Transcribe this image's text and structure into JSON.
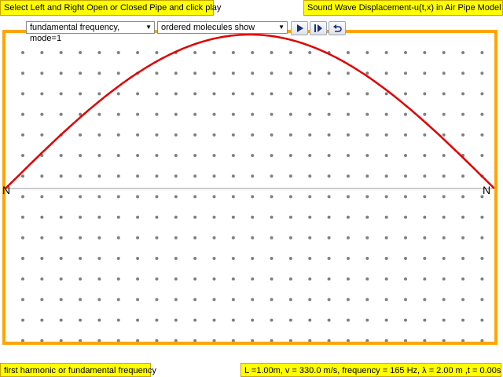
{
  "labels": {
    "top_left": "Select Left and Right Open or Closed Pipe and click play",
    "top_right": "Sound Wave Displacement-u(t,x) in Air Pipe Model",
    "bottom_left": "first harmonic or fundamental frequency",
    "bottom_right": "L =1.00m, v = 330.0 m/s, frequency = 165 Hz, λ = 2.00 m ,t = 0.00s"
  },
  "controls": {
    "mode_select": "fundamental frequency, mode=1",
    "view_select": "ordered molecules show",
    "play_icon": "play-icon",
    "step_icon": "step-forward-icon",
    "reset_icon": "reset-icon"
  },
  "nodes": {
    "left": "N",
    "right": "N"
  },
  "colors": {
    "wave": "#e00000",
    "border": "#ffa500",
    "label_bg": "#ffff00",
    "molecule": "#808080",
    "axis": "#999999"
  },
  "simulation": {
    "mode": 1,
    "molecule_columns": 25,
    "molecule_rows": 15
  }
}
